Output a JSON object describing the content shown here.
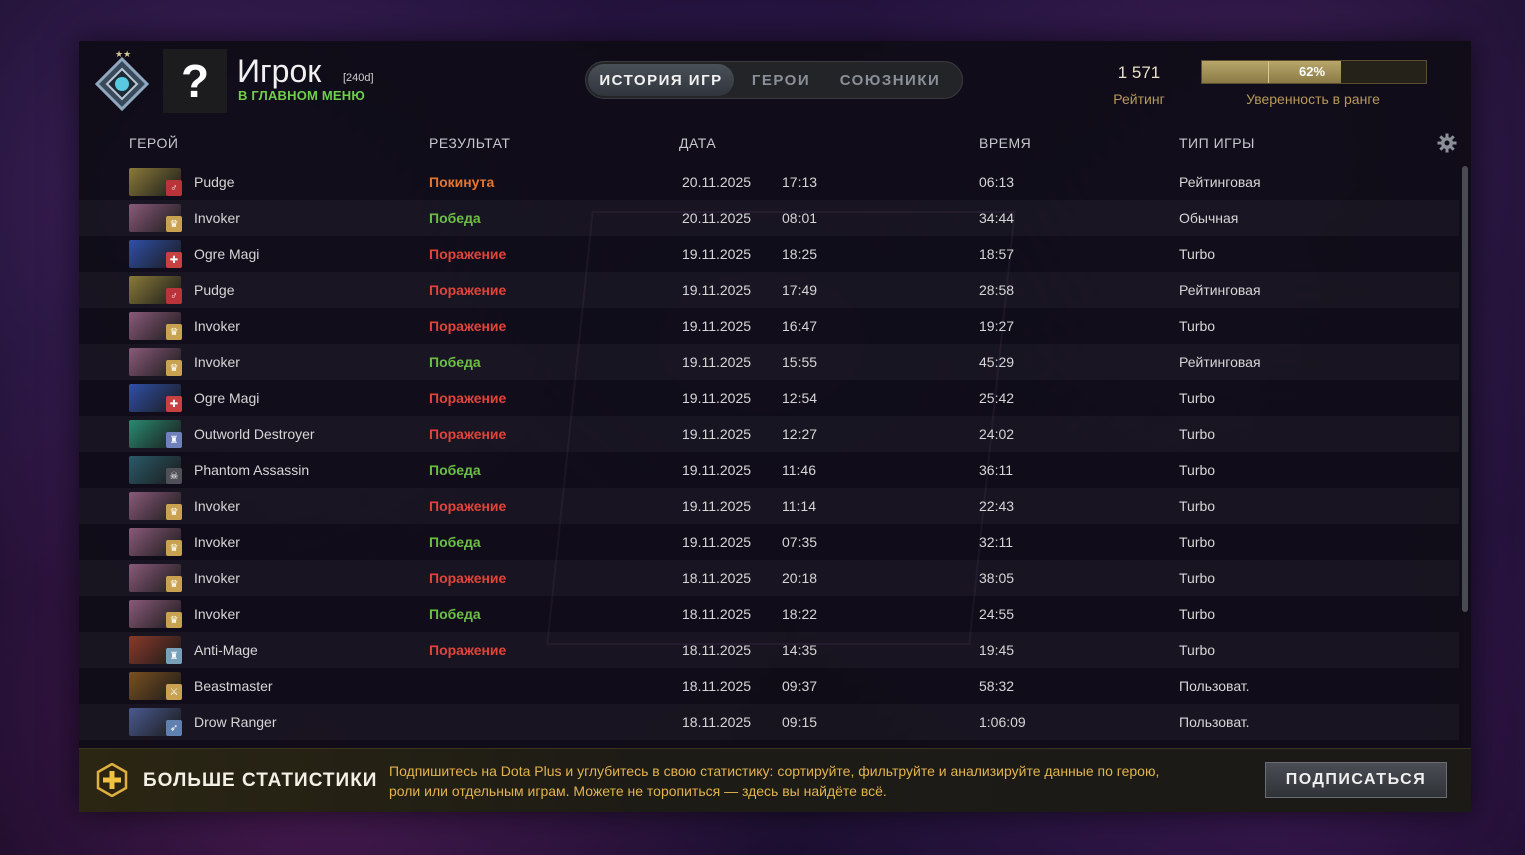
{
  "header": {
    "player_name": "Игрок",
    "player_tag": "[240d]",
    "status": "В ГЛАВНОМ МЕНЮ",
    "avatar_glyph": "?",
    "tabs": [
      {
        "label": "ИСТОРИЯ ИГР",
        "active": true
      },
      {
        "label": "ГЕРОИ",
        "active": false
      },
      {
        "label": "СОЮЗНИКИ",
        "active": false
      }
    ],
    "rating_value": "1 571",
    "rating_label": "Рейтинг",
    "confidence_value": "62%",
    "confidence_fraction": 0.62,
    "confidence_label": "Уверенность в ранге"
  },
  "columns": {
    "hero": "ГЕРОЙ",
    "result": "РЕЗУЛЬТАТ",
    "date": "ДАТА",
    "duration": "ВРЕМЯ",
    "game_type": "ТИП ИГРЫ"
  },
  "matches": [
    {
      "hero": "Pudge",
      "result": "Покинута",
      "result_kind": "left",
      "date": "20.11.2025",
      "time": "17:13",
      "duration": "06:13",
      "type": "Рейтинговая",
      "hero_color": "#8a7a3a",
      "badge_color": "#b8333a",
      "badge_icon": "♂"
    },
    {
      "hero": "Invoker",
      "result": "Победа",
      "result_kind": "win",
      "date": "20.11.2025",
      "time": "08:01",
      "duration": "34:44",
      "type": "Обычная",
      "hero_color": "#8a5a7a",
      "badge_color": "#c8a250",
      "badge_icon": "♛"
    },
    {
      "hero": "Ogre Magi",
      "result": "Поражение",
      "result_kind": "loss",
      "date": "19.11.2025",
      "time": "18:25",
      "duration": "18:57",
      "type": "Turbo",
      "hero_color": "#3050a8",
      "badge_color": "#c84040",
      "badge_icon": "✚"
    },
    {
      "hero": "Pudge",
      "result": "Поражение",
      "result_kind": "loss",
      "date": "19.11.2025",
      "time": "17:49",
      "duration": "28:58",
      "type": "Рейтинговая",
      "hero_color": "#8a7a3a",
      "badge_color": "#b8333a",
      "badge_icon": "♂"
    },
    {
      "hero": "Invoker",
      "result": "Поражение",
      "result_kind": "loss",
      "date": "19.11.2025",
      "time": "16:47",
      "duration": "19:27",
      "type": "Turbo",
      "hero_color": "#8a5a7a",
      "badge_color": "#c8a250",
      "badge_icon": "♛"
    },
    {
      "hero": "Invoker",
      "result": "Победа",
      "result_kind": "win",
      "date": "19.11.2025",
      "time": "15:55",
      "duration": "45:29",
      "type": "Рейтинговая",
      "hero_color": "#8a5a7a",
      "badge_color": "#c8a250",
      "badge_icon": "♛"
    },
    {
      "hero": "Ogre Magi",
      "result": "Поражение",
      "result_kind": "loss",
      "date": "19.11.2025",
      "time": "12:54",
      "duration": "25:42",
      "type": "Turbo",
      "hero_color": "#3050a8",
      "badge_color": "#c84040",
      "badge_icon": "✚"
    },
    {
      "hero": "Outworld Destroyer",
      "result": "Поражение",
      "result_kind": "loss",
      "date": "19.11.2025",
      "time": "12:27",
      "duration": "24:02",
      "type": "Turbo",
      "hero_color": "#2a8a70",
      "badge_color": "#7080b8",
      "badge_icon": "♜"
    },
    {
      "hero": "Phantom Assassin",
      "result": "Победа",
      "result_kind": "win",
      "date": "19.11.2025",
      "time": "11:46",
      "duration": "36:11",
      "type": "Turbo",
      "hero_color": "#2a5a6a",
      "badge_color": "#505058",
      "badge_icon": "☠"
    },
    {
      "hero": "Invoker",
      "result": "Поражение",
      "result_kind": "loss",
      "date": "19.11.2025",
      "time": "11:14",
      "duration": "22:43",
      "type": "Turbo",
      "hero_color": "#8a5a7a",
      "badge_color": "#c8a250",
      "badge_icon": "♛"
    },
    {
      "hero": "Invoker",
      "result": "Победа",
      "result_kind": "win",
      "date": "19.11.2025",
      "time": "07:35",
      "duration": "32:11",
      "type": "Turbo",
      "hero_color": "#8a5a7a",
      "badge_color": "#c8a250",
      "badge_icon": "♛"
    },
    {
      "hero": "Invoker",
      "result": "Поражение",
      "result_kind": "loss",
      "date": "18.11.2025",
      "time": "20:18",
      "duration": "38:05",
      "type": "Turbo",
      "hero_color": "#8a5a7a",
      "badge_color": "#c8a250",
      "badge_icon": "♛"
    },
    {
      "hero": "Invoker",
      "result": "Победа",
      "result_kind": "win",
      "date": "18.11.2025",
      "time": "18:22",
      "duration": "24:55",
      "type": "Turbo",
      "hero_color": "#8a5a7a",
      "badge_color": "#c8a250",
      "badge_icon": "♛"
    },
    {
      "hero": "Anti-Mage",
      "result": "Поражение",
      "result_kind": "loss",
      "date": "18.11.2025",
      "time": "14:35",
      "duration": "19:45",
      "type": "Turbo",
      "hero_color": "#8a3a2a",
      "badge_color": "#78a0b8",
      "badge_icon": "♜"
    },
    {
      "hero": "Beastmaster",
      "result": "",
      "result_kind": "none",
      "date": "18.11.2025",
      "time": "09:37",
      "duration": "58:32",
      "type": "Пользоват.",
      "hero_color": "#7a5020",
      "badge_color": "#c8a250",
      "badge_icon": "⚔"
    },
    {
      "hero": "Drow Ranger",
      "result": "",
      "result_kind": "none",
      "date": "18.11.2025",
      "time": "09:15",
      "duration": "1:06:09",
      "type": "Пользоват.",
      "hero_color": "#4a5a90",
      "badge_color": "#6080b0",
      "badge_icon": "➶"
    }
  ],
  "footer": {
    "title": "БОЛЬШЕ СТАТИСТИКИ",
    "promo_text": "Подпишитесь на Dota Plus и углубитесь в свою статистику: сортируйте, фильтруйте и анализируйте данные по герою, роли или отдельным играм. Можете не торопиться — здесь вы найдёте всё.",
    "subscribe_label": "ПОДПИСАТЬСЯ"
  },
  "colors": {
    "win": "#6cbf45",
    "loss": "#e0443a",
    "left": "#e8752e",
    "gold": "#b8995a"
  }
}
